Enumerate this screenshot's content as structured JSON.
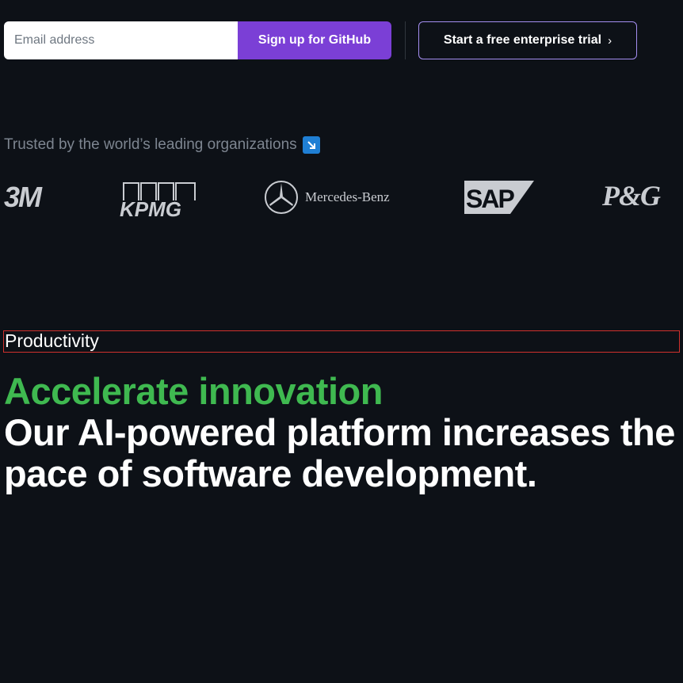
{
  "signup": {
    "email_placeholder": "Email address",
    "signup_label": "Sign up for GitHub",
    "trial_label": "Start a free enterprise trial",
    "trial_chevron": "›"
  },
  "trusted": {
    "text": "Trusted by the world’s leading organizations",
    "icon": "arrow-down-right-icon"
  },
  "logos": {
    "three_m": "3M",
    "kpmg": "KPMG",
    "mercedes": "Mercedes-Benz",
    "sap": "SAP",
    "pg": "P&G"
  },
  "productivity": {
    "eyebrow": "Productivity",
    "headline_accent": "Accelerate innovation",
    "headline_main": "Our AI-powered platform increases the pace of software development."
  },
  "colors": {
    "background": "#0d1117",
    "accent_purple": "#7b3fd6",
    "accent_green": "#3fb950",
    "trial_border": "#a48ef0",
    "muted_text": "#7d8590"
  }
}
